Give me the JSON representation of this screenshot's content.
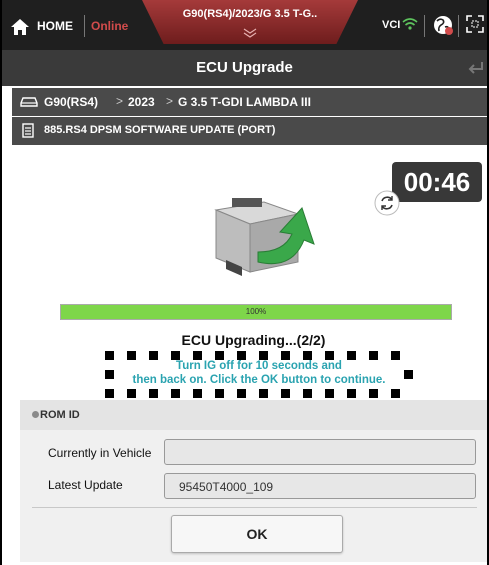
{
  "topbar": {
    "home_label": "HOME",
    "online_label": "Online",
    "vehicle_title": "G90(RS4)/2023/G 3.5 T-G..",
    "vci_label": "VCI"
  },
  "page": {
    "title": "ECU Upgrade"
  },
  "breadcrumb": {
    "items": [
      "G90(RS4)",
      "2023",
      "G 3.5 T-GDI LAMBDA III"
    ],
    "separator": ">"
  },
  "procedure": {
    "label": "885.RS4 DPSM SOFTWARE UPDATE (PORT)"
  },
  "upgrade": {
    "timer": "00:46",
    "progress_percent": 100,
    "progress_label": "100%",
    "status_title": "ECU Upgrading...(2/2)",
    "message_line1": "Turn IG off for 10 seconds and",
    "message_line2": "then back on. Click the OK button to continue."
  },
  "rom": {
    "header": "ROM ID",
    "current_label": "Currently in Vehicle",
    "current_value": "",
    "latest_label": "Latest Update",
    "latest_value": "95450T4000_109"
  },
  "actions": {
    "ok_label": "OK"
  },
  "colors": {
    "online": "#d14b4b",
    "progress": "#7ed64a",
    "message": "#2aa3b0",
    "vehicle_tab": "#8e2b2b"
  },
  "icons": [
    "home-icon",
    "chevron-down-icon",
    "wifi-icon",
    "globe-icon",
    "expand-icon",
    "back-icon",
    "car-icon",
    "document-icon",
    "refresh-icon",
    "ecu-upload-icon"
  ]
}
